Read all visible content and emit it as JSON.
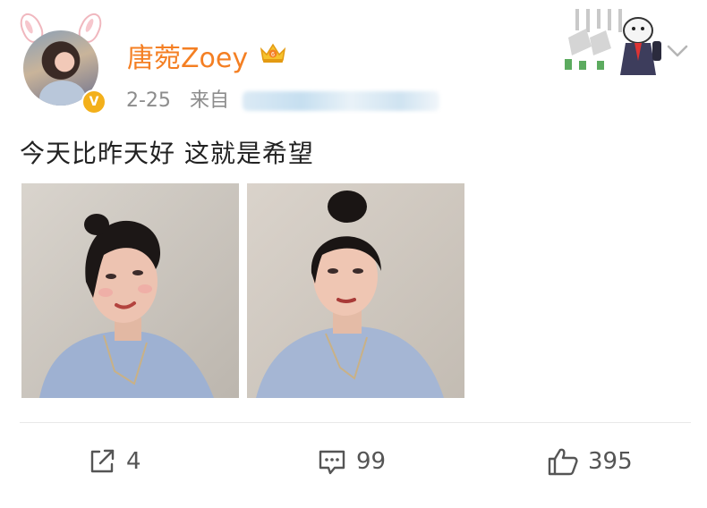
{
  "user": {
    "name": "唐菀Zoey",
    "verified_mark": "V"
  },
  "post": {
    "date": "2-25",
    "source_prefix": "来自",
    "text": "今天比昨天好  这就是希望"
  },
  "actions": {
    "repost_count": "4",
    "comment_count": "99",
    "like_count": "395"
  },
  "icons": [
    "bunny-ears-icon",
    "verified-badge-icon",
    "crown-vip-icon",
    "sticker-pendant",
    "chevron-down-icon",
    "repost-icon",
    "comment-icon",
    "like-icon"
  ],
  "colors": {
    "username": "#f47f23",
    "meta": "#8c8c8c",
    "text": "#222222",
    "verified": "#f3b01b"
  }
}
